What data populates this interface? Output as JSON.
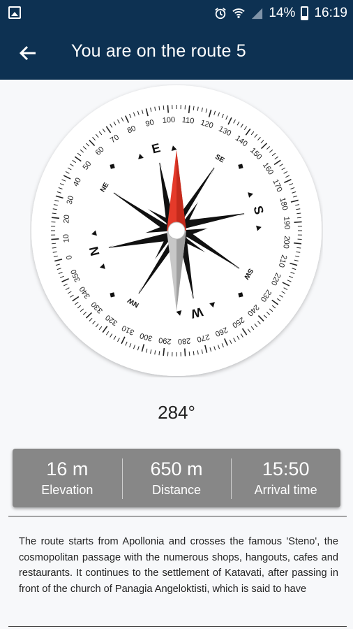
{
  "status_bar": {
    "battery": "14%",
    "time": "16:19",
    "icons": [
      "image-icon",
      "alarm-icon",
      "wifi-icon",
      "signal-icon",
      "battery-icon"
    ]
  },
  "app_bar": {
    "title": "You are on the route 5",
    "back_icon": "arrow-left-icon"
  },
  "compass": {
    "heading": "284°",
    "cardinals": [
      "N",
      "E",
      "S",
      "W"
    ],
    "intercardinals": [
      "NE",
      "SE",
      "SW",
      "NW"
    ],
    "degree_labels": [
      "0",
      "10",
      "20",
      "30",
      "40",
      "50",
      "60",
      "70",
      "80",
      "90",
      "100",
      "110",
      "120",
      "130",
      "140",
      "150",
      "160",
      "170",
      "180",
      "190",
      "200",
      "210",
      "220",
      "230",
      "240",
      "250",
      "260",
      "270",
      "280",
      "290",
      "300",
      "310",
      "320",
      "330",
      "340",
      "350"
    ],
    "colors": {
      "needle_north": "#e53a2a",
      "needle_south": "#c8c8c8",
      "rose": "#111111"
    }
  },
  "stats": [
    {
      "value": "16 m",
      "label": "Elevation"
    },
    {
      "value": "650 m",
      "label": "Distance"
    },
    {
      "value": "15:50",
      "label": "Arrival time"
    }
  ],
  "description": "The route starts from Apollonia and crosses the famous 'Steno', the cosmopolitan passage with the numerous shops, hangouts, cafes and restaurants. It continues to the settlement of Katavati, after passing in front of the church of Panagia Angeloktisti, which is said to have"
}
